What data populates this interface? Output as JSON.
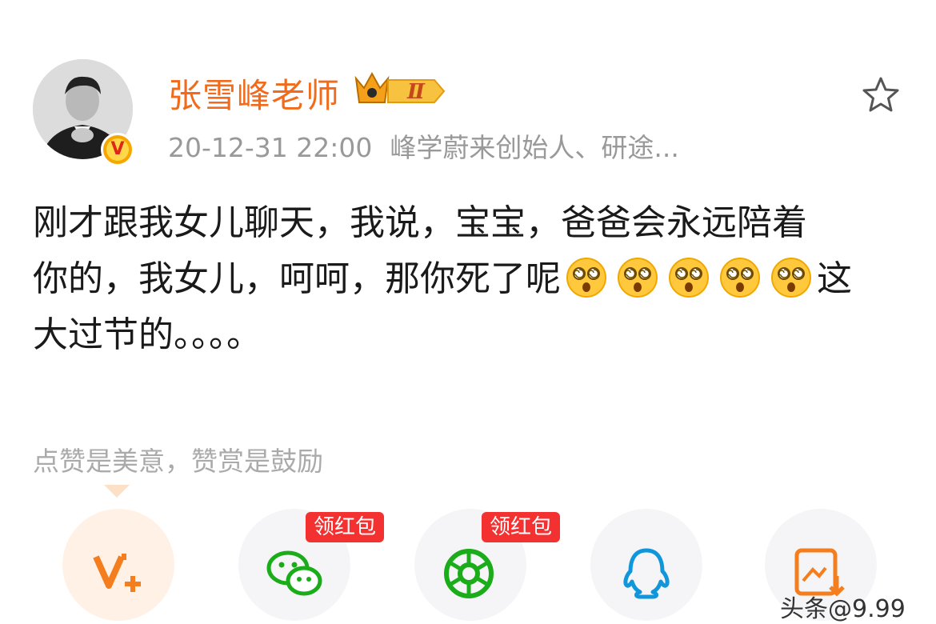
{
  "post": {
    "author": "张雪峰老师",
    "level_badge": "Ⅱ",
    "verified_mark": "V",
    "time": "20-12-31 22:00",
    "bio": "峰学蔚来创始人、研途...",
    "favorite_icon": "star-icon",
    "content_lines": [
      "刚才跟我女儿聊天，我说，宝宝，爸爸会永远陪着",
      "你的，我女儿，呵呵，那你死了呢",
      "这",
      "大过节的。。。。"
    ],
    "emoji": "dizzy-face-emoji",
    "emoji_count": 5
  },
  "reward_tip": "点赞是美意，赞赏是鼓励",
  "share": {
    "badge_text": "领红包",
    "items": [
      {
        "icon": "vplus-icon"
      },
      {
        "icon": "wechat-icon"
      },
      {
        "icon": "moments-icon"
      },
      {
        "icon": "qq-icon"
      },
      {
        "icon": "save-image-icon"
      }
    ]
  },
  "watermark": "头条@9.99"
}
